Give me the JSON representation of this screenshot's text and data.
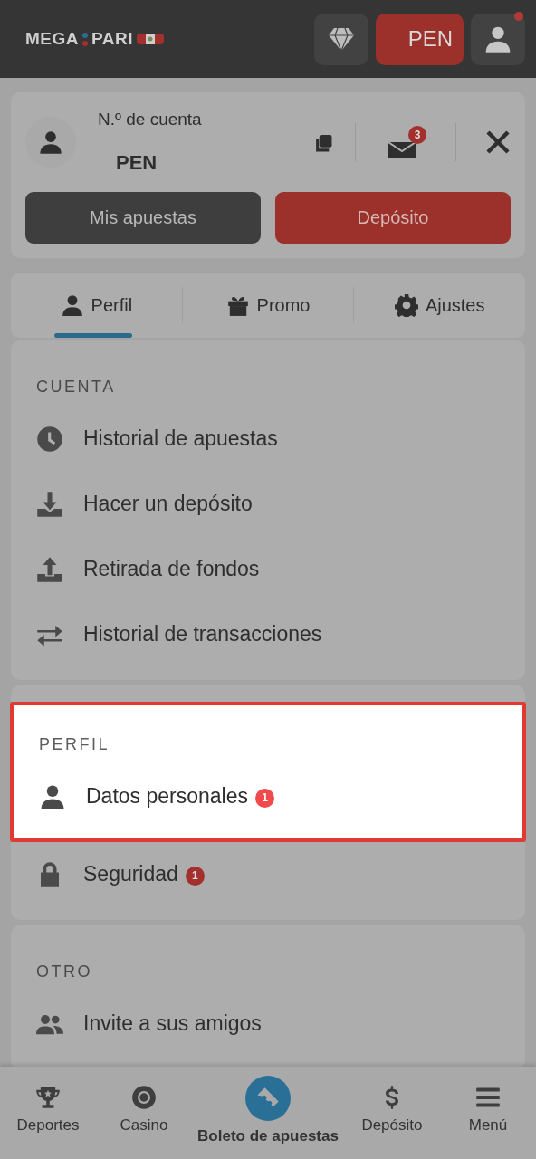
{
  "header": {
    "logo": {
      "left": "MEGA",
      "right": "PARI"
    },
    "currency_button": "PEN",
    "profile_notification": true
  },
  "account": {
    "label": "N.º de cuenta",
    "currency": "PEN",
    "messages_count": "3",
    "buttons": [
      {
        "label": "Mis apuestas",
        "kind": "dark"
      },
      {
        "label": "Depósito",
        "kind": "primary"
      }
    ]
  },
  "tabs": [
    {
      "label": "Perfil",
      "selected": true
    },
    {
      "label": "Promo",
      "selected": false
    },
    {
      "label": "Ajustes",
      "selected": false
    }
  ],
  "sections": [
    {
      "title": "CUENTA",
      "title_highlighted": false,
      "items": [
        {
          "label": "Historial de apuestas",
          "highlighted": false
        },
        {
          "label": "Hacer un depósito",
          "highlighted": false
        },
        {
          "label": "Retirada de fondos",
          "highlighted": false
        },
        {
          "label": "Historial de transacciones",
          "highlighted": false
        }
      ]
    },
    {
      "title": "PERFIL",
      "title_highlighted": true,
      "items": [
        {
          "label": "Datos personales",
          "badge": "1",
          "highlighted": true
        },
        {
          "label": "Seguridad",
          "badge": "1",
          "highlighted": false
        }
      ]
    },
    {
      "title": "OTRO",
      "title_highlighted": false,
      "items": [
        {
          "label": "Invite a sus amigos",
          "highlighted": false
        }
      ]
    }
  ],
  "bottom_nav": [
    {
      "label": "Deportes",
      "selected": false
    },
    {
      "label": "Casino",
      "selected": false
    },
    {
      "label": "Boleto de apuestas",
      "selected": true
    },
    {
      "label": "Depósito",
      "selected": false
    },
    {
      "label": "Menú",
      "selected": false
    }
  ]
}
